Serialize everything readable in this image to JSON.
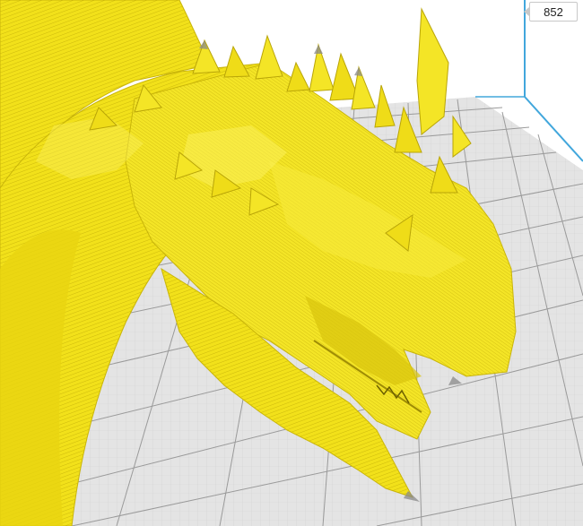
{
  "layer_view": {
    "current_layer": "852"
  },
  "colors": {
    "model": "#f2e11a",
    "model_shadow": "#c9b50a",
    "model_highlight": "#fbf05a",
    "build_plate": "#e4e4e4",
    "grid_line": "#9a9a9a",
    "grid_fine": "#c8c8c8",
    "plate_edge": "#42a7dc",
    "background": "#ffffff"
  },
  "icons": [
    "layer-number-box"
  ]
}
